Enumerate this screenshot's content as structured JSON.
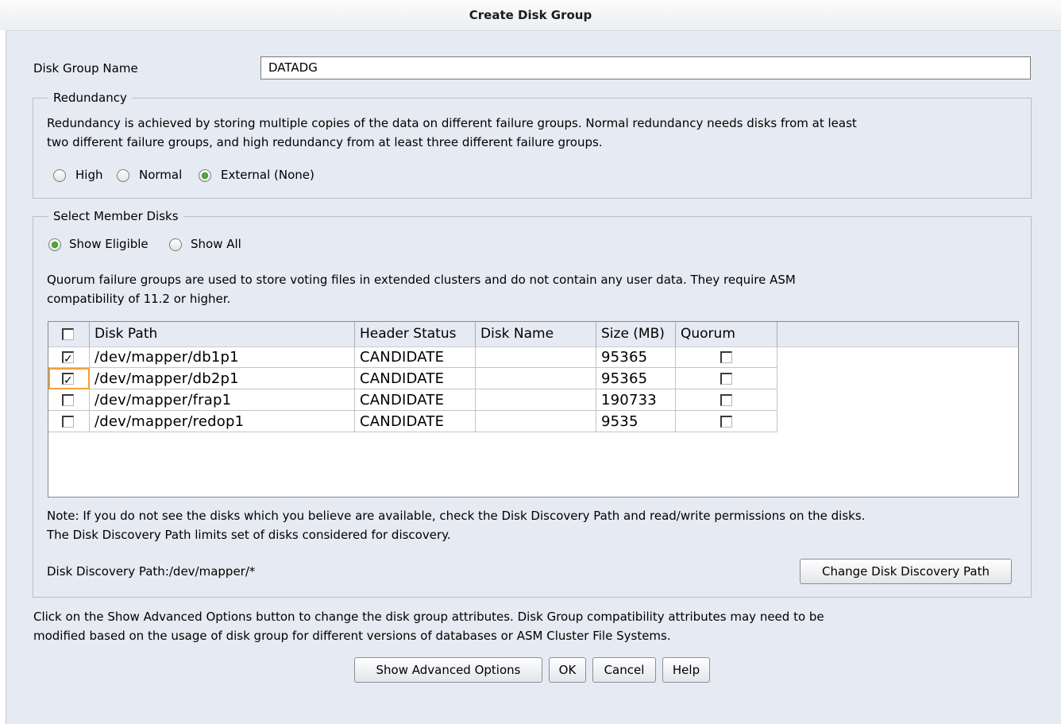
{
  "window": {
    "title": "Create Disk Group"
  },
  "disk_group_name": {
    "label": "Disk Group Name",
    "value": "DATADG"
  },
  "redundancy": {
    "legend": "Redundancy",
    "description_line1": "Redundancy is achieved by storing multiple copies of the data on different failure groups. Normal redundancy needs disks from at least",
    "description_line2": "two different failure groups, and high redundancy from at least three different failure groups.",
    "options": [
      {
        "label": "High",
        "selected": false
      },
      {
        "label": "Normal",
        "selected": false
      },
      {
        "label": "External (None)",
        "selected": true
      }
    ]
  },
  "member_disks": {
    "legend": "Select Member Disks",
    "filter_options": [
      {
        "label": "Show Eligible",
        "selected": true
      },
      {
        "label": "Show All",
        "selected": false
      }
    ],
    "quorum_note_line1": "Quorum failure groups are used to store voting files in extended clusters and do not contain any user data. They require ASM",
    "quorum_note_line2": "compatibility of 11.2 or higher.",
    "table": {
      "columns": [
        "Disk Path",
        "Header Status",
        "Disk Name",
        "Size (MB)",
        "Quorum"
      ],
      "rows": [
        {
          "selected": true,
          "path": "/dev/mapper/db1p1",
          "status": "CANDIDATE",
          "name": "",
          "size": "95365",
          "quorum": false
        },
        {
          "selected": true,
          "path": "/dev/mapper/db2p1",
          "status": "CANDIDATE",
          "name": "",
          "size": "95365",
          "quorum": false
        },
        {
          "selected": false,
          "path": "/dev/mapper/frap1",
          "status": "CANDIDATE",
          "name": "",
          "size": "190733",
          "quorum": false
        },
        {
          "selected": false,
          "path": "/dev/mapper/redop1",
          "status": "CANDIDATE",
          "name": "",
          "size": "9535",
          "quorum": false
        }
      ]
    },
    "discovery_note_line1": "Note: If you do not see the disks which you believe are available, check the Disk Discovery Path and read/write permissions on the disks.",
    "discovery_note_line2": "The Disk Discovery Path limits set of disks considered for discovery.",
    "discovery_path": "Disk Discovery Path:/dev/mapper/*",
    "change_path_button": "Change Disk Discovery Path"
  },
  "advanced_note_line1": "Click on the Show Advanced Options button to change the disk group attributes. Disk Group compatibility attributes may need to be",
  "advanced_note_line2": "modified based on the usage of disk group for different versions of databases or ASM Cluster File Systems.",
  "buttons": {
    "advanced": "Show Advanced Options",
    "ok": "OK",
    "cancel": "Cancel",
    "help": "Help"
  }
}
